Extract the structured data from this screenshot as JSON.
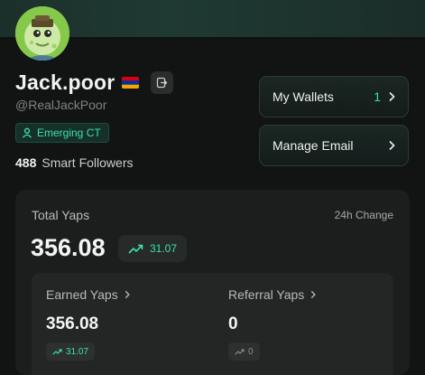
{
  "profile": {
    "username": "Jack.poor",
    "handle": "@RealJackPoor",
    "badge": "Emerging CT",
    "followers_count": "488",
    "followers_label": "Smart Followers"
  },
  "actions": {
    "wallets_label": "My Wallets",
    "wallets_count": "1",
    "email_label": "Manage Email"
  },
  "yaps": {
    "total_label": "Total Yaps",
    "change_label": "24h Change",
    "total_value": "356.08",
    "total_change": "31.07",
    "earned_label": "Earned Yaps",
    "earned_value": "356.08",
    "earned_change": "31.07",
    "referral_label": "Referral Yaps",
    "referral_value": "0",
    "referral_change": "0"
  },
  "colors": {
    "accent": "#3ee0ad",
    "background": "#121413",
    "card": "#1b1e1d"
  }
}
